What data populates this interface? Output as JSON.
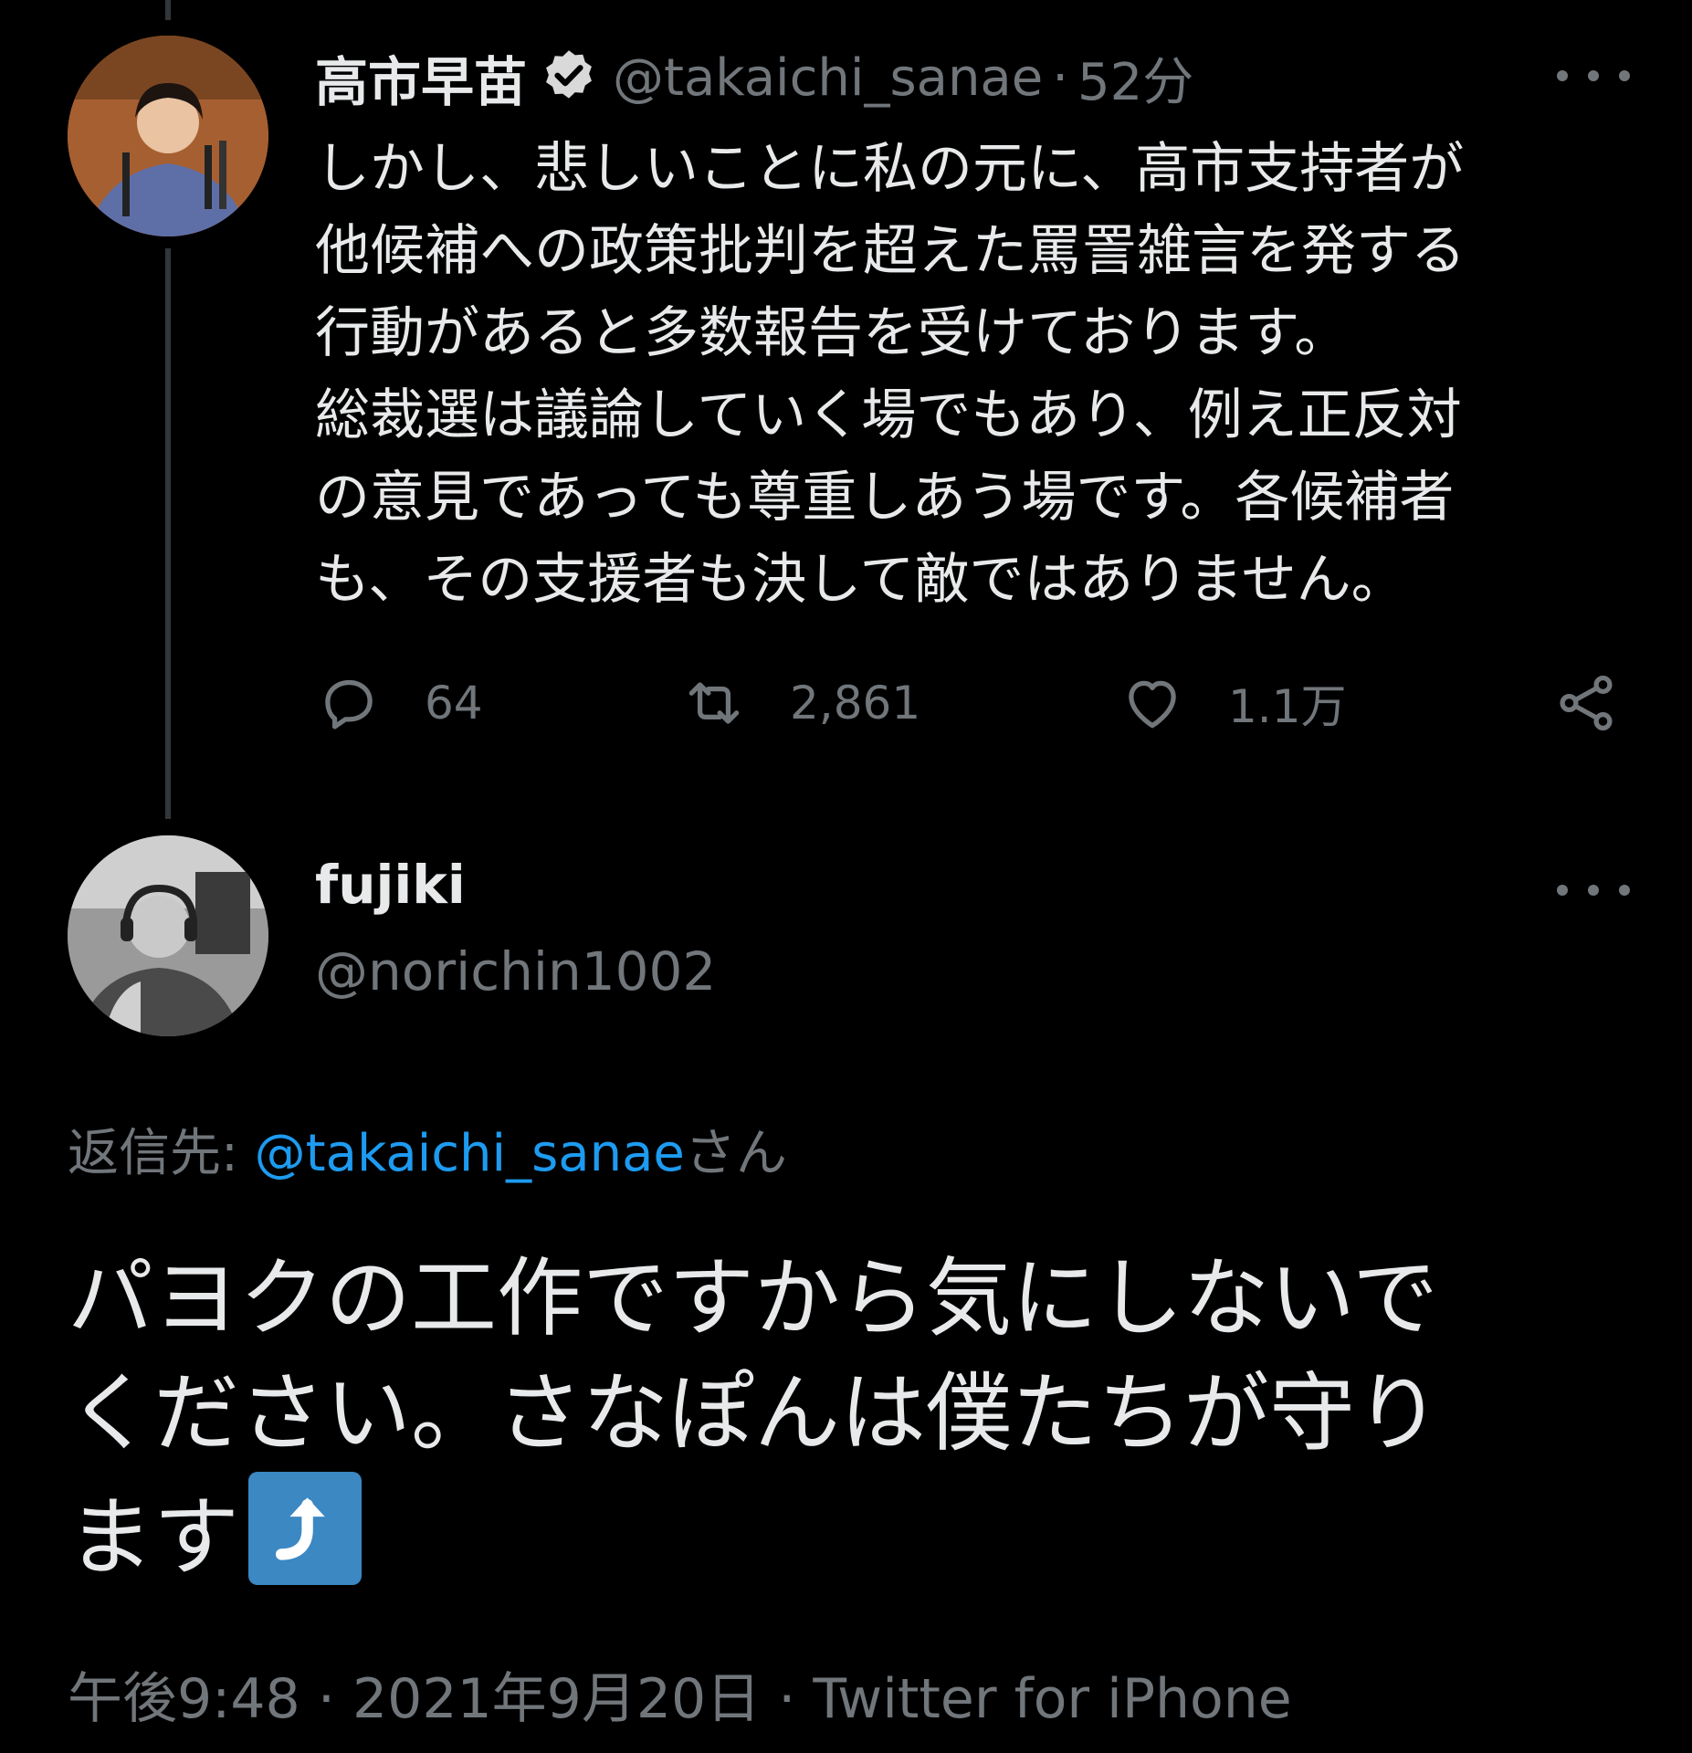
{
  "original_tweet": {
    "display_name": "高市早苗",
    "verified_icon": "verified-badge-icon",
    "handle": "@takaichi_sanae",
    "separator": "·",
    "time_ago": "52分",
    "body_lines": [
      "しかし、悲しいことに私の元に、高市支持者が",
      "他候補への政策批判を超えた罵詈雑言を発する",
      "行動があると多数報告を受けております。",
      "総裁選は議論していく場でもあり、例え正反対",
      "の意見であっても尊重しあう場です。各候補者",
      "も、その支援者も決して敵ではありません。"
    ],
    "reply_count": "64",
    "retweet_count": "2,861",
    "like_count": "1.1万"
  },
  "reply_tweet": {
    "display_name": "fujiki",
    "handle": "@norichin1002",
    "replying_to_prefix": "返信先: ",
    "replying_to_handle": "@takaichi_sanae",
    "replying_to_suffix": "さん",
    "body_lines": [
      "パヨクの工作ですから気にしないで",
      "ください。さなぽんは僕たちが守り",
      "ます"
    ],
    "emoji": "right-arrow-curving-up-emoji",
    "timestamp": "午後9:48",
    "date": "2021年9月20日",
    "source": "Twitter for iPhone",
    "meta_separator": " · "
  },
  "colors": {
    "background": "#000000",
    "primary_text": "#e7e9ea",
    "secondary_text": "#71767b",
    "link": "#1d9bf0",
    "thread_line": "#333639",
    "emoji_blue": "#3b88c3"
  }
}
